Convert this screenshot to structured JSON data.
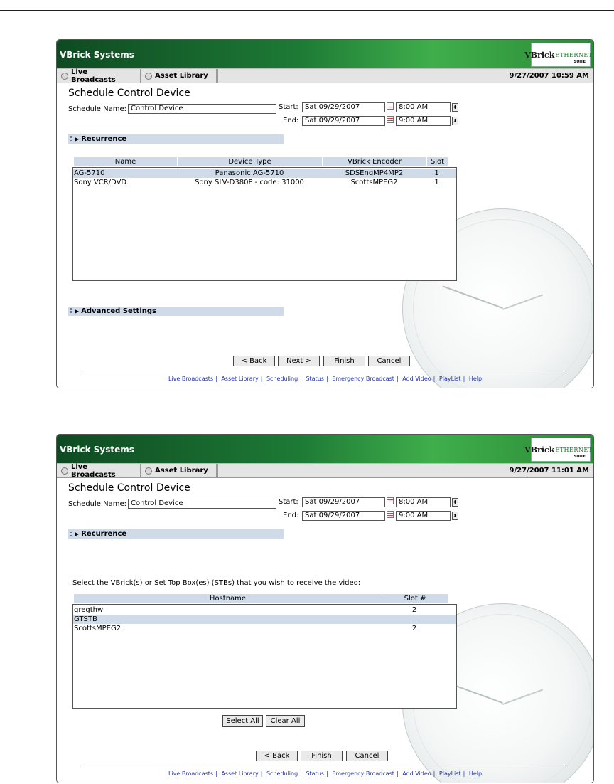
{
  "app": {
    "title": "VBrick Systems",
    "logo_main": "VBrick",
    "logo_sub": "ETHERNETV",
    "logo_suite": "SUITE"
  },
  "tabs": [
    {
      "label": "Live Broadcasts"
    },
    {
      "label": "Asset Library"
    }
  ],
  "form": {
    "title": "Schedule Control Device",
    "name_label": "Schedule Name:",
    "name_value": "Control Device",
    "start_label": "Start:",
    "end_label": "End:",
    "start_date": "Sat 09/29/2007",
    "start_time": "8:00 AM",
    "end_date": "Sat 09/29/2007",
    "end_time": "9:00 AM",
    "recurrence_label": "Recurrence",
    "advanced_label": "Advanced Settings"
  },
  "screen1": {
    "datetime": "9/27/2007 10:59 AM",
    "columns": [
      "Name",
      "Device Type",
      "VBrick Encoder",
      "Slot"
    ],
    "rows": [
      {
        "name": "AG-5710",
        "device_type": "Panasonic AG-5710",
        "encoder": "SDSEngMP4MP2",
        "slot": "1"
      },
      {
        "name": "Sony VCR/DVD",
        "device_type": "Sony SLV-D380P - code: 31000",
        "encoder": "ScottsMPEG2",
        "slot": "1"
      }
    ],
    "buttons": {
      "back": "< Back",
      "next": "Next >",
      "finish": "Finish",
      "cancel": "Cancel"
    }
  },
  "screen2": {
    "datetime": "9/27/2007 11:01 AM",
    "prompt": "Select the VBrick(s) or Set Top Box(es) (STBs) that you wish to receive the video:",
    "columns": [
      "Hostname",
      "Slot #"
    ],
    "rows": [
      {
        "hostname": "gregthw",
        "slot": "2"
      },
      {
        "hostname": "GTSTB",
        "slot": ""
      },
      {
        "hostname": "ScottsMPEG2",
        "slot": "2"
      }
    ],
    "select_all": "Select All",
    "clear_all": "Clear All",
    "buttons": {
      "back": "< Back",
      "finish": "Finish",
      "cancel": "Cancel"
    }
  },
  "footer": {
    "links": [
      "Live Broadcasts",
      "Asset Library",
      "Scheduling",
      "Status",
      "Emergency Broadcast",
      "Add Video",
      "PlayList",
      "Help"
    ],
    "separator": "|"
  },
  "colors": {
    "header_green": "#1d7a35",
    "row_highlight": "#cfdbe9",
    "link_blue": "#2233aa"
  }
}
